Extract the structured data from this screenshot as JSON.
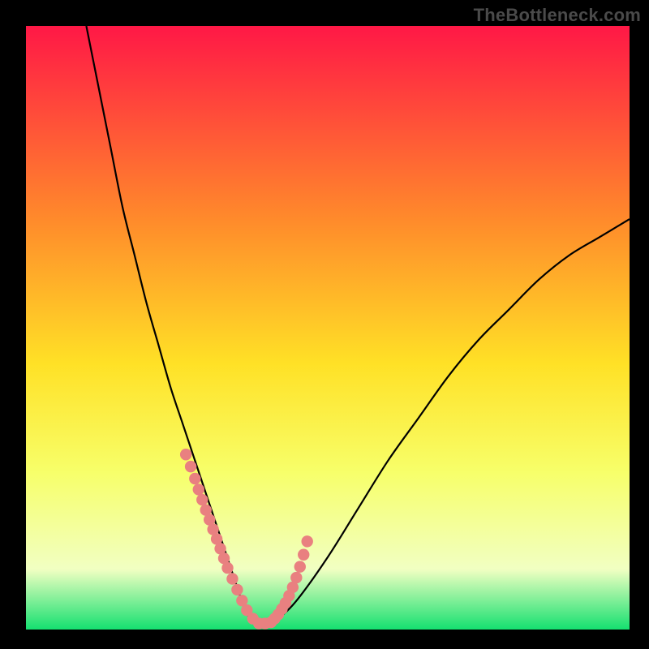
{
  "watermark": "TheBottleneck.com",
  "colors": {
    "frame": "#000000",
    "gradient_top": "#ff1846",
    "gradient_upper_mid": "#ff8a2b",
    "gradient_mid": "#ffe126",
    "gradient_lower_mid": "#f7ff6a",
    "gradient_low": "#f1ffc2",
    "gradient_bottom": "#15e070",
    "curve": "#000000",
    "dots": "#e98080"
  },
  "chart_data": {
    "type": "line",
    "title": "",
    "xlabel": "",
    "ylabel": "",
    "xlim": [
      0,
      100
    ],
    "ylim": [
      0,
      100
    ],
    "grid": false,
    "legend": false,
    "series": [
      {
        "name": "bottleneck-curve",
        "x": [
          10,
          12,
          14,
          16,
          18,
          20,
          22,
          24,
          26,
          28,
          30,
          32,
          33,
          34,
          35,
          36,
          37,
          38,
          40,
          42,
          45,
          50,
          55,
          60,
          65,
          70,
          75,
          80,
          85,
          90,
          95,
          100
        ],
        "y": [
          100,
          90,
          80,
          70,
          62,
          54,
          47,
          40,
          34,
          28,
          22,
          16,
          13,
          10,
          7,
          4,
          2,
          1,
          1,
          2,
          5,
          12,
          20,
          28,
          35,
          42,
          48,
          53,
          58,
          62,
          65,
          68
        ]
      }
    ],
    "markers": [
      {
        "name": "lower-curve-dots",
        "x": [
          26.5,
          27.3,
          28.0,
          28.6,
          29.2,
          29.8,
          30.4,
          31.0,
          31.6,
          32.2,
          32.8,
          33.4,
          34.2,
          35.0,
          35.8,
          36.6,
          37.6,
          38.6,
          39.6,
          40.6,
          41.2,
          41.8,
          42.4,
          43.0,
          43.6,
          44.2,
          44.8,
          45.4,
          46.0,
          46.6
        ],
        "y": [
          29.0,
          27.0,
          25.0,
          23.2,
          21.5,
          19.8,
          18.2,
          16.6,
          15.0,
          13.4,
          11.8,
          10.2,
          8.4,
          6.6,
          4.8,
          3.2,
          1.8,
          1.0,
          1.0,
          1.2,
          1.8,
          2.5,
          3.4,
          4.4,
          5.6,
          7.0,
          8.6,
          10.4,
          12.4,
          14.6
        ]
      }
    ]
  }
}
